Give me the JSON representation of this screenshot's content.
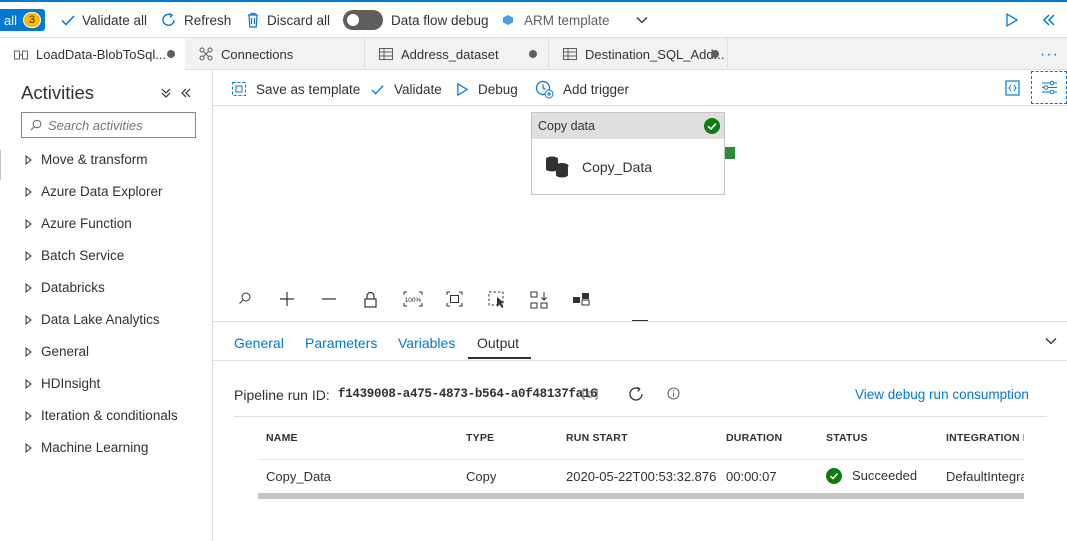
{
  "toolbar": {
    "publish_all_label": "all",
    "publish_badge": "3",
    "validate_all": "Validate all",
    "refresh": "Refresh",
    "discard_all": "Discard all",
    "data_flow_debug": "Data flow debug",
    "arm_template": "ARM template"
  },
  "tabs": [
    {
      "label": "LoadData-BlobToSql..."
    },
    {
      "label": "Connections"
    },
    {
      "label": "Address_dataset"
    },
    {
      "label": "Destination_SQL_Add..."
    }
  ],
  "sidebar": {
    "title": "Activities",
    "search_placeholder": "Search activities",
    "items": [
      {
        "label": "Move & transform"
      },
      {
        "label": "Azure Data Explorer"
      },
      {
        "label": "Azure Function"
      },
      {
        "label": "Batch Service"
      },
      {
        "label": "Databricks"
      },
      {
        "label": "Data Lake Analytics"
      },
      {
        "label": "General"
      },
      {
        "label": "HDInsight"
      },
      {
        "label": "Iteration & conditionals"
      },
      {
        "label": "Machine Learning"
      }
    ]
  },
  "canvas_toolbar": {
    "save_as_template": "Save as template",
    "validate": "Validate",
    "debug": "Debug",
    "add_trigger": "Add trigger"
  },
  "activity": {
    "header": "Copy data",
    "name": "Copy_Data"
  },
  "output_panel": {
    "tabs": [
      "General",
      "Parameters",
      "Variables",
      "Output"
    ],
    "active_tab": "Output",
    "pipeline_run_label": "Pipeline run ID:",
    "pipeline_run_id": "f1439008-a475-4873-b564-a0f48137fa16",
    "view_consumption": "View debug run consumption",
    "columns": [
      "NAME",
      "TYPE",
      "RUN START",
      "DURATION",
      "STATUS",
      "INTEGRATION RU"
    ],
    "rows": [
      {
        "name": "Copy_Data",
        "type": "Copy",
        "run_start": "2020-05-22T00:53:32.876",
        "duration": "00:00:07",
        "status": "Succeeded",
        "integration": "DefaultIntegra"
      }
    ]
  },
  "colors": {
    "accent": "#0078d4",
    "success": "#107c10",
    "badge": "#ffb900"
  }
}
